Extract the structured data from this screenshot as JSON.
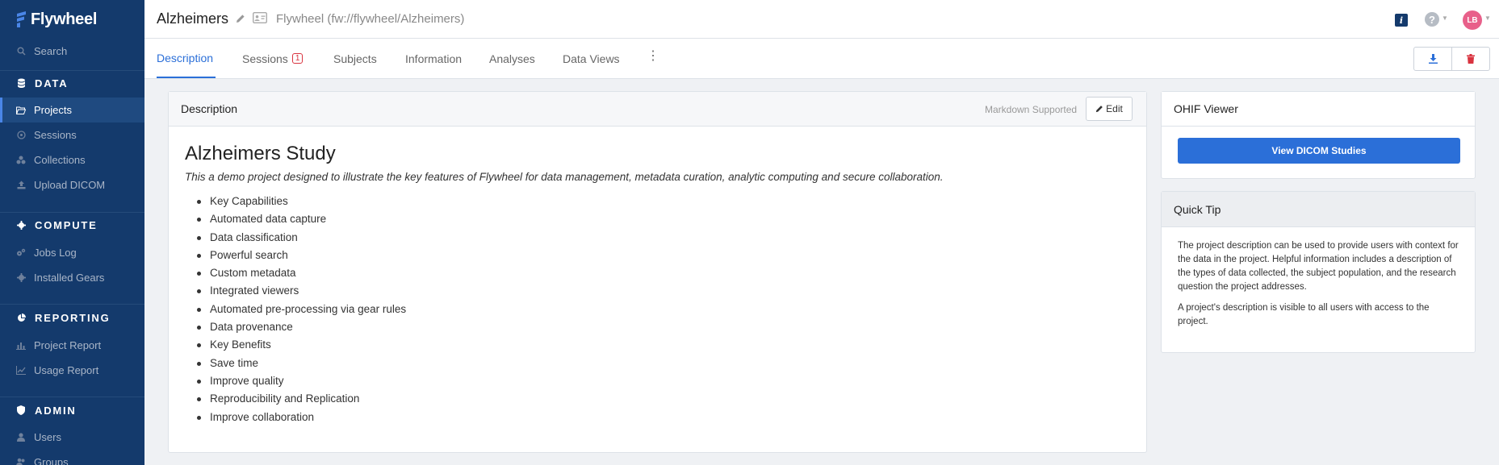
{
  "brand": {
    "name": "Flywheel"
  },
  "sidebar": {
    "search": "Search",
    "sections": {
      "data": "DATA",
      "compute": "COMPUTE",
      "reporting": "REPORTING",
      "admin": "ADMIN"
    },
    "items": {
      "projects": "Projects",
      "sessions": "Sessions",
      "collections": "Collections",
      "upload_dicom": "Upload DICOM",
      "jobs_log": "Jobs Log",
      "installed_gears": "Installed Gears",
      "project_report": "Project Report",
      "usage_report": "Usage Report",
      "users": "Users",
      "groups": "Groups"
    }
  },
  "header": {
    "project_title": "Alzheimers",
    "project_path": "Flywheel (fw://flywheel/Alzheimers)",
    "avatar_initials": "LB",
    "info_glyph": "i",
    "help_glyph": "?"
  },
  "tabs": {
    "description": "Description",
    "sessions": "Sessions",
    "sessions_badge": "1",
    "subjects": "Subjects",
    "information": "Information",
    "analyses": "Analyses",
    "data_views": "Data Views"
  },
  "description_panel": {
    "title": "Description",
    "markdown_note": "Markdown Supported",
    "edit_label": "Edit",
    "study_title": "Alzheimers Study",
    "study_subtitle": "This a demo project designed to illustrate the key features of Flywheel for data management, metadata curation, analytic computing and secure collaboration.",
    "items": [
      "Key Capabilities",
      "Automated data capture",
      "Data classification",
      "Powerful search",
      "Custom metadata",
      "Integrated viewers",
      "Automated pre-processing via gear rules",
      "Data provenance",
      "Key Benefits",
      "Save time",
      "Improve quality",
      "Reproducibility and Replication",
      "Improve collaboration"
    ]
  },
  "ohif_panel": {
    "title": "OHIF Viewer",
    "button_label": "View DICOM Studies"
  },
  "tip_panel": {
    "title": "Quick Tip",
    "paragraph1": "The project description can be used to provide users with context for the data in the project. Helpful information includes a description of the types of data collected, the subject population, and the research question the project addresses.",
    "paragraph2": "A project's description is visible to all users with access to the project."
  },
  "colors": {
    "sidebar_bg": "#143a6c",
    "accent": "#2b6fd8",
    "danger": "#d9333f",
    "avatar": "#e8608a"
  }
}
